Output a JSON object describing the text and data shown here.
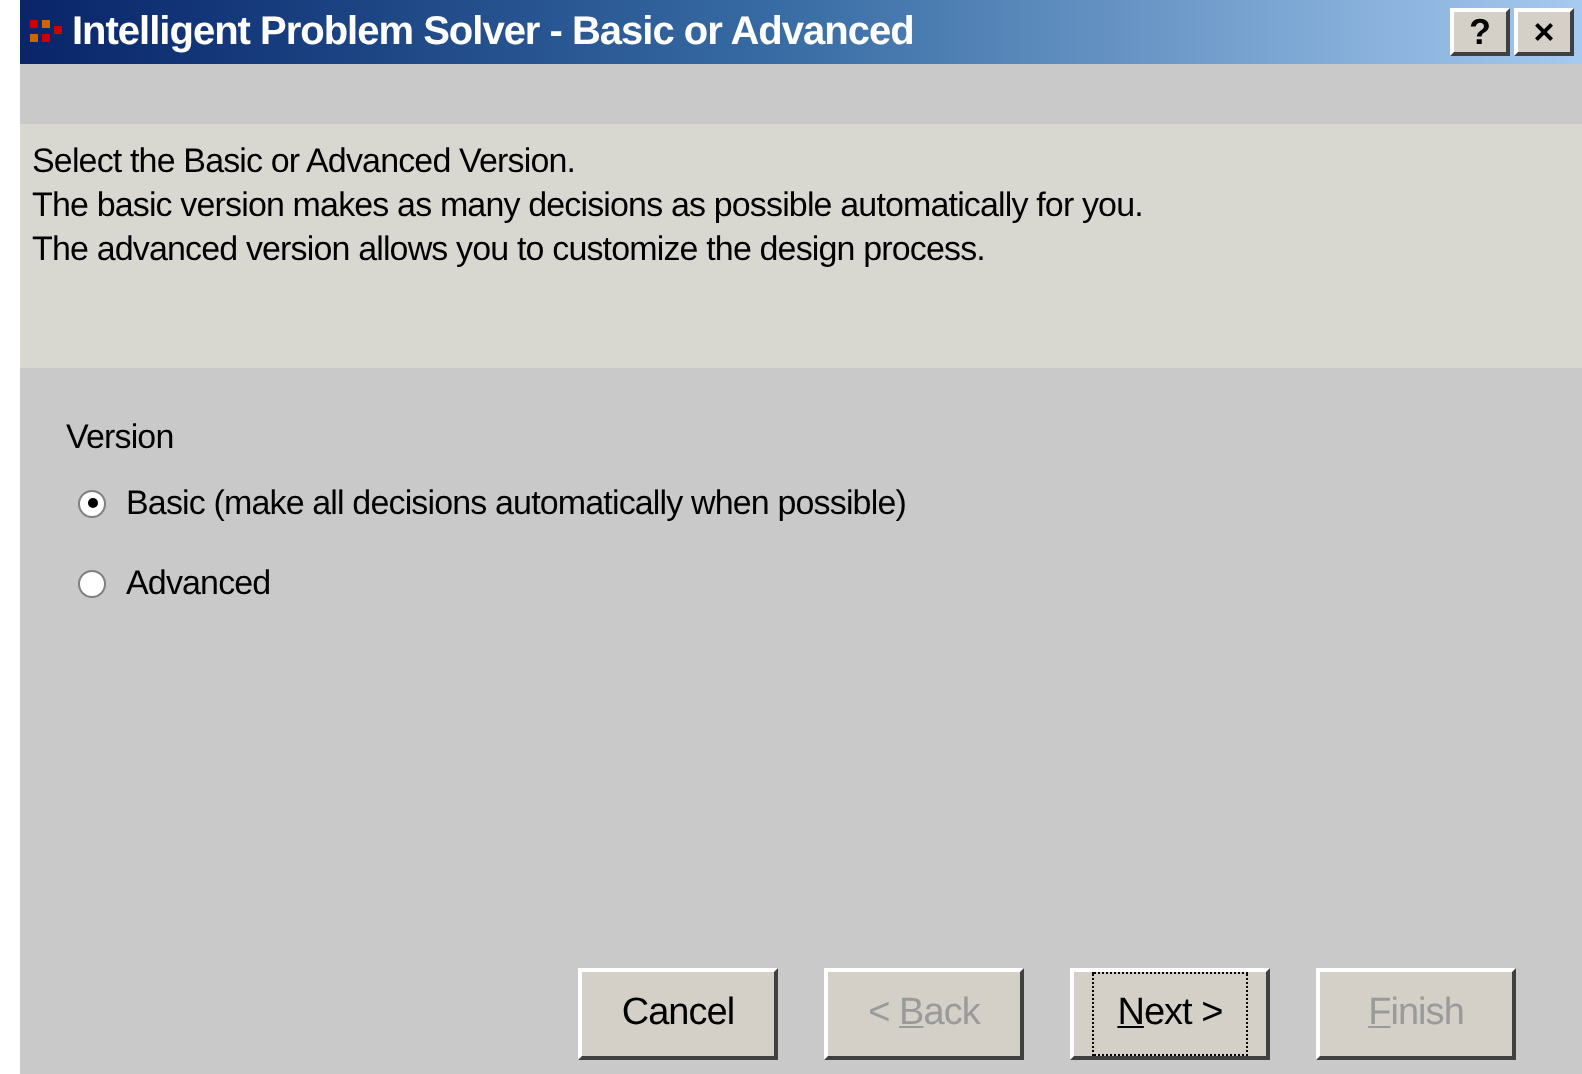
{
  "window": {
    "title": "Intelligent Problem Solver - Basic or Advanced",
    "controls": [
      "?",
      "×"
    ]
  },
  "info": [
    "Select the Basic or Advanced Version.",
    "The basic version makes as many decisions as possible automatically for you.",
    "The advanced version allows you to customize the design process."
  ],
  "version_group": {
    "label": "Version",
    "options": [
      {
        "label": "Basic (make all decisions automatically when possible)",
        "selected": true
      },
      {
        "label": "Advanced",
        "selected": false
      }
    ]
  },
  "buttons": [
    {
      "label": "Cancel",
      "disabled": false,
      "focused": false
    },
    {
      "prefix": "< ",
      "mnemonic": "B",
      "suffix": "ack",
      "disabled": true,
      "focused": false
    },
    {
      "mnemonic": "N",
      "suffix": "ext >",
      "disabled": false,
      "focused": true
    },
    {
      "mnemonic": "F",
      "suffix": "inish",
      "disabled": true,
      "focused": false
    }
  ]
}
